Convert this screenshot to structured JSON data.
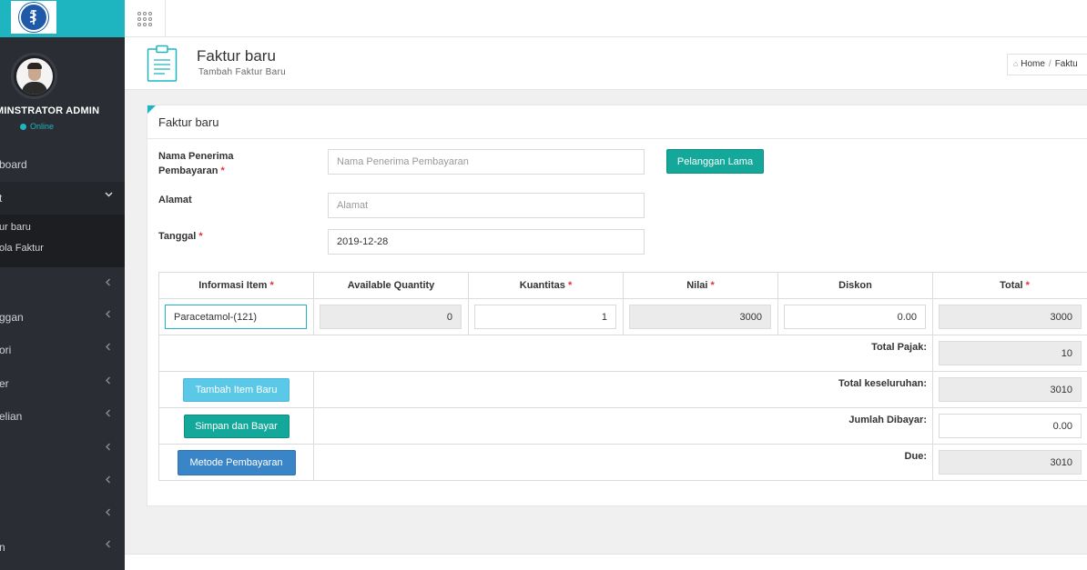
{
  "sidebar": {
    "admin_name": "MINSTRATOR ADMIN",
    "status": "Online",
    "items": [
      {
        "label": "board"
      },
      {
        "label": "t"
      },
      {
        "label": ""
      },
      {
        "label": "ggan"
      },
      {
        "label": "ori"
      },
      {
        "label": "er"
      },
      {
        "label": "elian"
      },
      {
        "label": ""
      },
      {
        "label": ""
      },
      {
        "label": ""
      },
      {
        "label": "n"
      }
    ],
    "sub_items": [
      {
        "label": "ur baru"
      },
      {
        "label": "ola Faktur"
      }
    ]
  },
  "header": {
    "title": "Faktur baru",
    "subtitle": "Tambah Faktur Baru",
    "breadcrumb_home": "Home",
    "breadcrumb_sep": "/",
    "breadcrumb_current": "Faktu"
  },
  "panel": {
    "title": "Faktur baru"
  },
  "form": {
    "recipient_label_1": "Nama Penerima",
    "recipient_label_2": "Pembayaran",
    "recipient_placeholder": "Nama Penerima Pembayaran",
    "old_customer_button": "Pelanggan Lama",
    "address_label": "Alamat",
    "address_placeholder": "Alamat",
    "date_label": "Tanggal",
    "date_value": "2019-12-28",
    "required_mark": "*"
  },
  "table": {
    "headers": [
      {
        "label": "Informasi Item",
        "required": true
      },
      {
        "label": "Available Quantity",
        "required": false
      },
      {
        "label": "Kuantitas",
        "required": true
      },
      {
        "label": "Nilai",
        "required": true
      },
      {
        "label": "Diskon",
        "required": false
      },
      {
        "label": "Total",
        "required": true
      }
    ],
    "row": {
      "item": "Paracetamol-(121)",
      "available_quantity": "0",
      "quantity": "1",
      "value": "3000",
      "discount": "0.00",
      "total": "3000"
    },
    "summary": {
      "tax_label": "Total Pajak:",
      "tax_value": "10",
      "grand_total_label": "Total keseluruhan:",
      "grand_total_value": "3010",
      "paid_label": "Jumlah Dibayar:",
      "paid_value": "0.00",
      "due_label": "Due:",
      "due_value": "3010"
    },
    "buttons": {
      "add_item": "Tambah Item Baru",
      "save_pay": "Simpan dan Bayar",
      "payment_method": "Metode Pembayaran"
    }
  },
  "colors": {
    "accent": "#1eb5c0",
    "teal_button": "#14a89a",
    "light_button": "#5bc8e8",
    "blue_button": "#3a85c8",
    "required": "#e0323c",
    "sidebar_bg": "#2a2d33"
  },
  "icons": {
    "logo": "pharmacy-logo",
    "apps": "grid-icon",
    "page": "clipboard-icon",
    "home": "home-icon",
    "collapse": "chevron-left-icon",
    "expand": "chevron-down-icon"
  }
}
